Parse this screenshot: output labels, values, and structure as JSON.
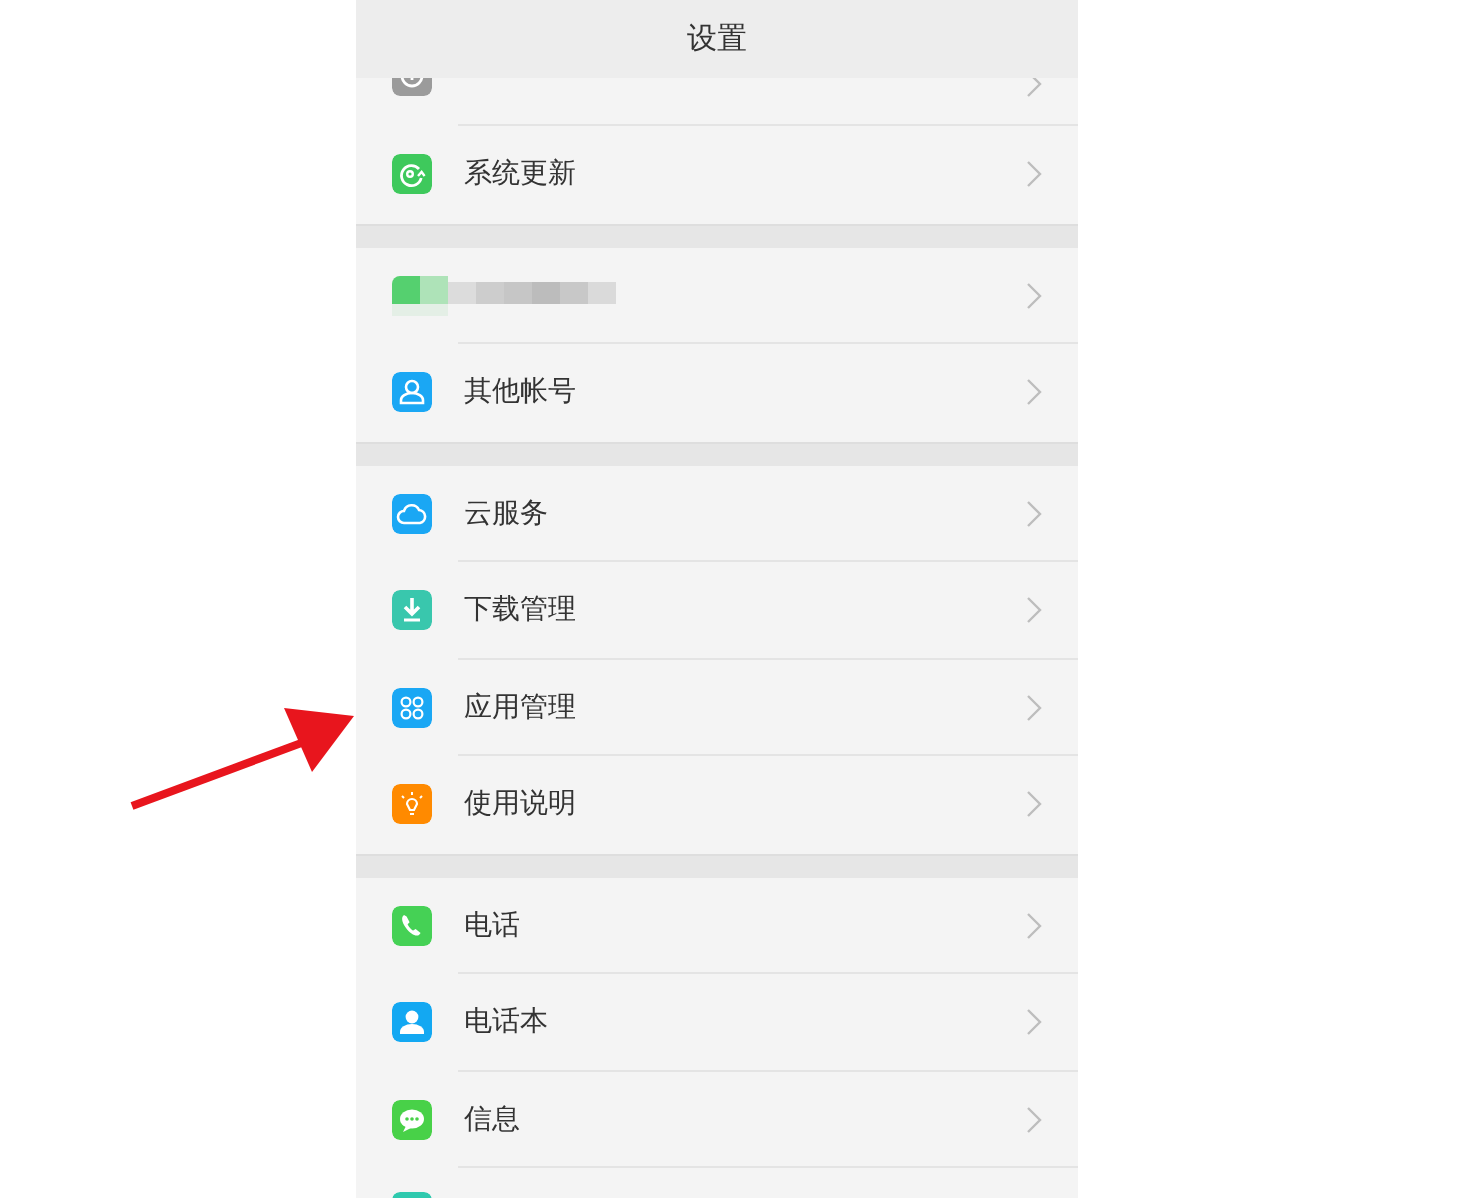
{
  "title": "设置",
  "sections": [
    {
      "rows": [
        {
          "kind": "partial-top"
        },
        {
          "kind": "item",
          "label": "系统更新"
        }
      ]
    },
    {
      "rows": [
        {
          "kind": "redacted"
        },
        {
          "kind": "item",
          "label": "其他帐号"
        }
      ]
    },
    {
      "rows": [
        {
          "kind": "item",
          "label": "云服务"
        },
        {
          "kind": "item",
          "label": "下载管理"
        },
        {
          "kind": "item",
          "label": "应用管理"
        },
        {
          "kind": "item",
          "label": "使用说明"
        }
      ]
    },
    {
      "rows": [
        {
          "kind": "item",
          "label": "电话"
        },
        {
          "kind": "item",
          "label": "电话本"
        },
        {
          "kind": "item",
          "label": "信息"
        },
        {
          "kind": "partial-bottom"
        }
      ]
    }
  ]
}
